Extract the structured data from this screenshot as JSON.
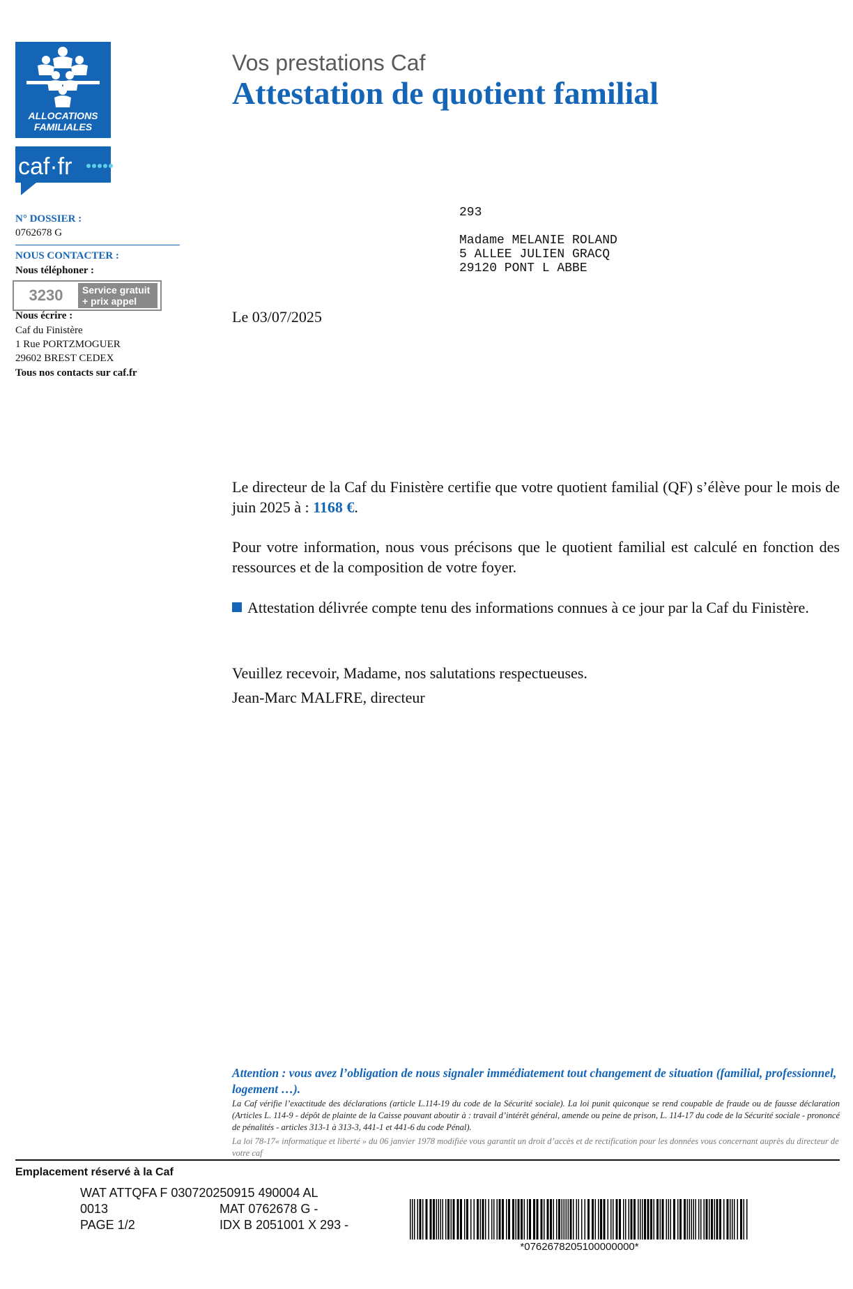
{
  "logo": {
    "brand_line1": "ALLOCATIONS",
    "brand_line2": "FAMILIALES",
    "site_text": "caf·fr",
    "brand_color": "#1565b7"
  },
  "header": {
    "subtitle": "Vos prestations Caf",
    "title": "Attestation de quotient familial"
  },
  "sidebar": {
    "dossier_label": "N° DOSSIER :",
    "dossier_number": "0762678 G",
    "contact_label": "NOUS CONTACTER :",
    "phone_label": "Nous téléphoner  :",
    "phone_number": "3230",
    "phone_tag_line1": "Service gratuit",
    "phone_tag_line2": "+ prix appel",
    "write_label": "Nous écrire :",
    "address_line1": "Caf du Finistère",
    "address_line2": "1 Rue PORTZMOGUER",
    "address_line3": "29602 BREST CEDEX",
    "contacts_all": "Tous nos contacts sur caf.fr"
  },
  "recipient": {
    "code": "293",
    "name": "Madame MELANIE ROLAND",
    "street": "5 ALLEE JULIEN GRACQ",
    "city": "29120 PONT L ABBE"
  },
  "letter": {
    "date": "Le 03/07/2025",
    "para1_text": "Le directeur de la Caf du Finistère certifie que votre quotient familial (QF) s’élève pour le mois de juin 2025 à : ",
    "qf_amount": "1168 €",
    "para1_end": ".",
    "para2": "Pour votre information, nous vous précisons que le quotient familial est calculé en fonction des ressources et de la composition de votre foyer.",
    "para3": "Attestation délivrée compte tenu des informations connues à ce jour par la Caf du Finistère.",
    "closing": "Veuillez recevoir, Madame, nos salutations respectueuses.",
    "signature": "Jean-Marc MALFRE, directeur"
  },
  "notice": {
    "attention": "Attention : vous avez l’obligation de nous signaler immédiatement tout changement de situation (familial, professionnel, logement …).",
    "legal": "La Caf vérifie l’exactitude des déclarations (article L.114-19 du code de la Sécurité sociale). La loi punit quiconque se rend coupable de fraude ou de fausse déclaration (Articles L. 114-9 - dépôt de plainte de la Caisse pouvant aboutir à : travail d’intérêt général, amende ou peine de prison, L. 114-17 du code de la Sécurité sociale - prononcé de pénalités - articles 313-1 à 313-3, 441-1 et 441-6 du code Pénal).",
    "loi": "La loi 78-17« informatique et liberté » du 06 janvier 1978 modifiée vous garantit un droit d’accès et de rectification pour les données vous concernant auprès du directeur de votre caf"
  },
  "footer": {
    "reserved": "Emplacement réservé à la Caf",
    "line1": "WAT ATTQFA  F 030720250915 490004 AL",
    "line2a": "0013",
    "line2b": "MAT 0762678 G -",
    "line3a": "PAGE 1/2",
    "line3b": "IDX B 2051001 X 293 -",
    "barcode_text": "*0762678205100000000*"
  }
}
